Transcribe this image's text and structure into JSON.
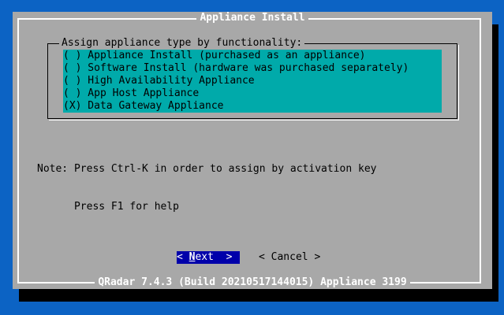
{
  "dialog": {
    "title": "Appliance Install",
    "footer": "QRadar 7.4.3 (Build 20210517144015) Appliance 3199"
  },
  "group": {
    "label": "Assign appliance type by functionality:",
    "options": [
      {
        "text": "( ) Appliance Install (purchased as an appliance)",
        "selected": false
      },
      {
        "text": "( ) Software Install (hardware was purchased separately)",
        "selected": false
      },
      {
        "text": "( ) High Availability Appliance",
        "selected": false
      },
      {
        "text": "( ) App Host Appliance",
        "selected": false
      },
      {
        "text": "(X) Data Gateway Appliance",
        "selected": true
      }
    ]
  },
  "note": {
    "line1": "Note: Press Ctrl-K in order to assign by activation key",
    "line2": "      Press F1 for help"
  },
  "buttons": {
    "next_prefix": "< ",
    "next_hotkey": "N",
    "next_rest": "ext  >",
    "cancel": "< Cancel >"
  },
  "colors": {
    "screen_bg": "#0c63c4",
    "dialog_bg": "#a8a8a8",
    "list_bg": "#00aaaa",
    "button_focus_bg": "#0000aa"
  }
}
